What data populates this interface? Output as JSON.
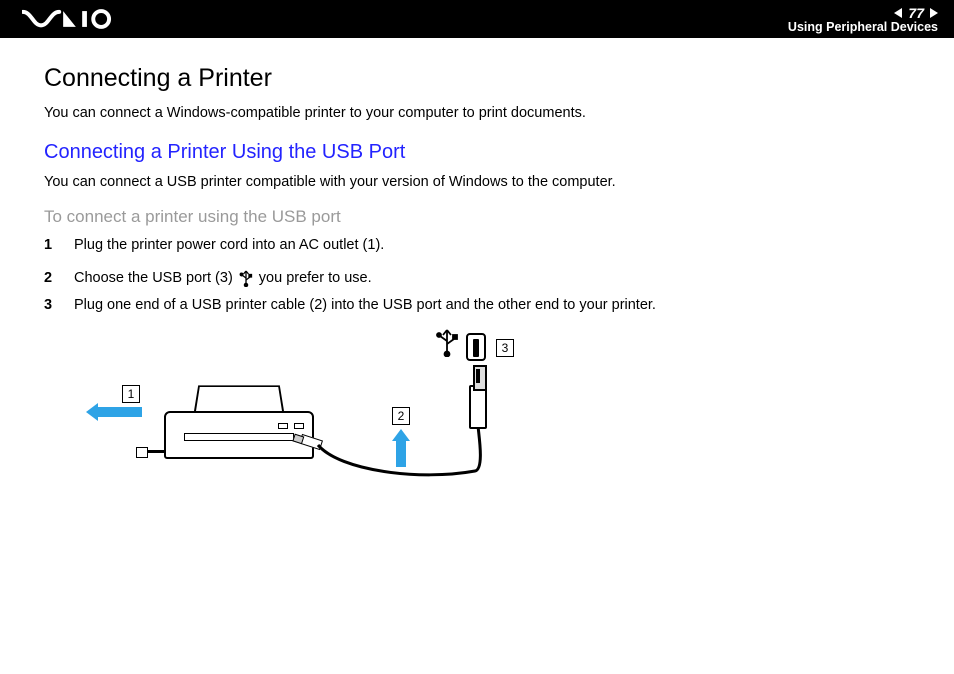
{
  "header": {
    "page_number": "77",
    "section": "Using Peripheral Devices"
  },
  "content": {
    "h1": "Connecting a Printer",
    "intro": "You can connect a Windows-compatible printer to your computer to print documents.",
    "h2": "Connecting a Printer Using the USB Port",
    "intro2": "You can connect a USB printer compatible with your version of Windows to the computer.",
    "h3": "To connect a printer using the USB port",
    "steps": [
      {
        "num": "1",
        "text": "Plug the printer power cord into an AC outlet (1)."
      },
      {
        "num": "2",
        "text_before": "Choose the USB port (3)",
        "text_after": "you prefer to use."
      },
      {
        "num": "3",
        "text": "Plug one end of a USB printer cable (2) into the USB port and the other end to your printer."
      }
    ]
  },
  "diagram": {
    "callout_1": "1",
    "callout_2": "2",
    "callout_3": "3"
  }
}
